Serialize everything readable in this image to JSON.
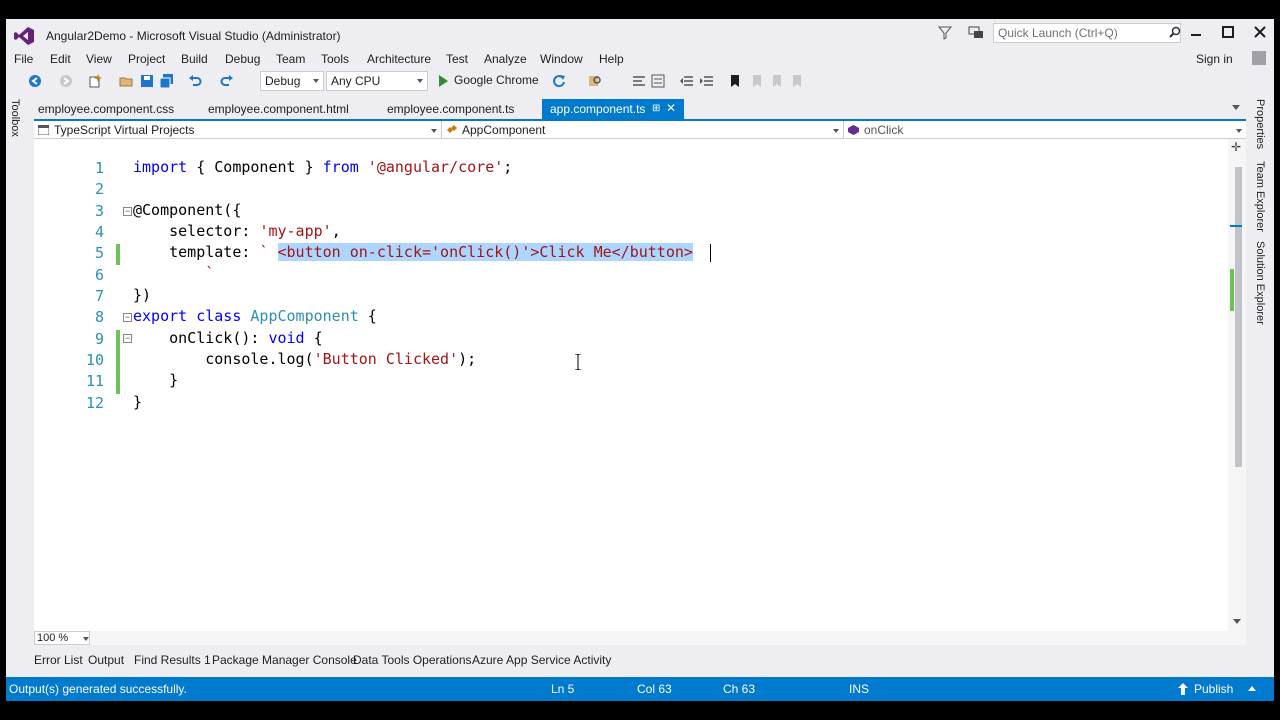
{
  "window": {
    "title": "Angular2Demo - Microsoft Visual Studio (Administrator)",
    "quick_launch_placeholder": "Quick Launch (Ctrl+Q)",
    "sign_in": "Sign in"
  },
  "menu": [
    "File",
    "Edit",
    "View",
    "Project",
    "Build",
    "Debug",
    "Team",
    "Tools",
    "Architecture",
    "Test",
    "Analyze",
    "Window",
    "Help"
  ],
  "toolbar": {
    "configuration": "Debug",
    "platform": "Any CPU",
    "run_target": "Google Chrome"
  },
  "toolbox_label": "Toolbox",
  "tabs": [
    {
      "label": "employee.component.css",
      "active": false
    },
    {
      "label": "employee.component.html",
      "active": false
    },
    {
      "label": "employee.component.ts",
      "active": false
    },
    {
      "label": "app.component.ts",
      "active": true
    }
  ],
  "navbar": {
    "project": "TypeScript Virtual Projects",
    "type": "AppComponent",
    "member": "onClick"
  },
  "editor": {
    "line_numbers": [
      "1",
      "2",
      "3",
      "4",
      "5",
      "6",
      "7",
      "8",
      "9",
      "10",
      "11",
      "12"
    ],
    "lines": {
      "l1_kw1": "import",
      "l1_mid": " { Component } ",
      "l1_kw2": "from",
      "l1_str": " '@angular/core'",
      "l1_end": ";",
      "l3": "@Component({",
      "l4_key": "    selector: ",
      "l4_str": "'my-app'",
      "l4_end": ",",
      "l5_key": "    template: ",
      "l5_str": "` ",
      "l5_sel": "<button on-click='onClick()'>Click Me</button>",
      "l6": "        `",
      "l7": "})",
      "l8_kw1": "export",
      "l8_sp": " ",
      "l8_kw2": "class",
      "l8_sp2": " ",
      "l8_typ": "AppComponent",
      "l8_end": " {",
      "l9_pre": "    onClick(): ",
      "l9_kw": "void",
      "l9_end": " {",
      "l10_pre": "        console.log(",
      "l10_str": "'Button Clicked'",
      "l10_end": ");",
      "l11": "    }",
      "l12": "}"
    }
  },
  "right_panels": [
    "Properties",
    "Team Explorer",
    "Solution Explorer"
  ],
  "zoom": "100 %",
  "bottom_tabs": [
    "Error List",
    "Output",
    "Find Results 1",
    "Package Manager Console",
    "Data Tools Operations",
    "Azure App Service Activity"
  ],
  "status": {
    "message": "Output(s) generated successfully.",
    "line": "Ln 5",
    "col": "Col 63",
    "ch": "Ch 63",
    "mode": "INS",
    "publish": "Publish"
  },
  "colors": {
    "accent": "#007acc",
    "keyword": "#0000ff",
    "string": "#a31515",
    "type": "#2b91af",
    "selection": "#add6ff",
    "change_marker": "#6ac259"
  }
}
